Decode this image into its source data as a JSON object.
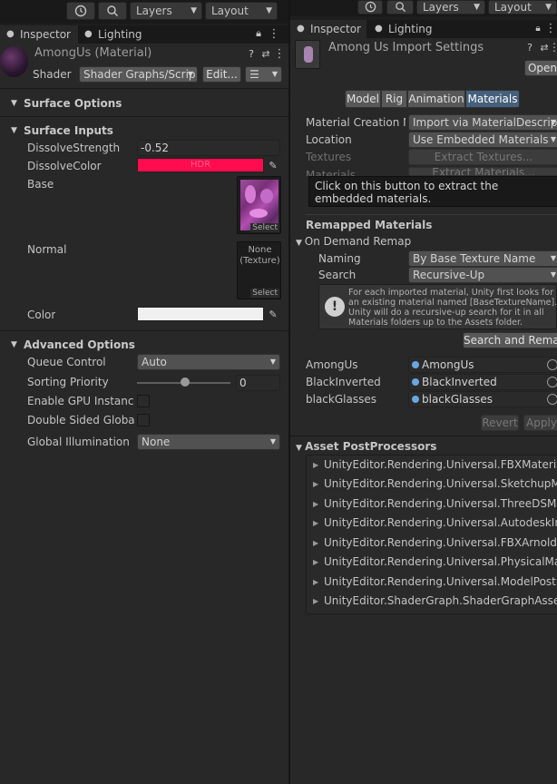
{
  "toolbar_left": {
    "history_icon": "history-icon",
    "search_icon": "search-icon",
    "layers": "Layers",
    "layout": "Layout"
  },
  "toolbar_right": {
    "history_icon": "history-icon",
    "search_icon": "search-icon",
    "layers": "Layers",
    "layout": "Layout"
  },
  "left": {
    "tabs": [
      {
        "label": "Inspector",
        "icon": "info-icon"
      },
      {
        "label": "Lighting",
        "icon": "lightbulb-icon"
      }
    ],
    "material_name": "AmongUs (Material)",
    "shader_label": "Shader",
    "shader_value": "Shader Graphs/Scrip",
    "edit_button": "Edit...",
    "surface_options": "Surface Options",
    "surface_inputs": "Surface Inputs",
    "dissolve_strength_label": "DissolveStrength",
    "dissolve_strength_value": "-0.52",
    "dissolve_color_label": "DissolveColor",
    "dissolve_color_hex": "#ff0b4f",
    "dissolve_color_hdr": "HDR",
    "base_label": "Base",
    "normal_label": "Normal",
    "normal_none": "None (Texture)",
    "select": "Select",
    "color_label": "Color",
    "advanced_options": "Advanced Options",
    "queue_control_label": "Queue Control",
    "queue_control_value": "Auto",
    "sorting_priority_label": "Sorting Priority",
    "sorting_priority_value": "0",
    "gpu_instancing_label": "Enable GPU Instancin",
    "double_sided_label": "Double Sided Global I",
    "global_illumination_label": "Global Illumination",
    "global_illumination_value": "None"
  },
  "right": {
    "tabs": [
      {
        "label": "Inspector",
        "icon": "info-icon"
      },
      {
        "label": "Lighting",
        "icon": "lightbulb-icon"
      }
    ],
    "title": "Among Us Import Settings",
    "open_button": "Open",
    "subtabs": [
      "Model",
      "Rig",
      "Animation",
      "Materials"
    ],
    "material_creation_label": "Material Creation Mo",
    "material_creation_value": "Import via MaterialDescriptio",
    "location_label": "Location",
    "location_value": "Use Embedded Materials",
    "textures_label": "Textures",
    "extract_textures": "Extract Textures...",
    "materials_label": "Materials",
    "extract_materials": "Extract Materials...",
    "tooltip": "Click on this button to extract the embedded materials.",
    "remapped_materials": "Remapped Materials",
    "on_demand_remap": "On Demand Remap",
    "naming_label": "Naming",
    "naming_value": "By Base Texture Name",
    "search_label": "Search",
    "search_value": "Recursive-Up",
    "info_text": "For each imported material, Unity first looks for an existing material named [BaseTextureName]. Unity will do a recursive-up search for it in all Materials folders up to the Assets folder.",
    "search_remap_button": "Search and Remap",
    "remaps": [
      {
        "label": "AmongUs",
        "value": "AmongUs"
      },
      {
        "label": "BlackInverted",
        "value": "BlackInverted"
      },
      {
        "label": "blackGlasses",
        "value": "blackGlasses"
      }
    ],
    "revert": "Revert",
    "apply": "Apply",
    "asset_postprocessors": "Asset PostProcessors",
    "processors": [
      "UnityEditor.Rendering.Universal.FBXMaterialDesc",
      "UnityEditor.Rendering.Universal.SketchupMateria",
      "UnityEditor.Rendering.Universal.ThreeDSMateria",
      "UnityEditor.Rendering.Universal.AutodeskInteract",
      "UnityEditor.Rendering.Universal.FBXArnoldSurfac",
      "UnityEditor.Rendering.Universal.PhysicalMaterial",
      "UnityEditor.Rendering.Universal.ModelPostproce",
      "UnityEditor.ShaderGraph.ShaderGraphAssetPost"
    ]
  }
}
